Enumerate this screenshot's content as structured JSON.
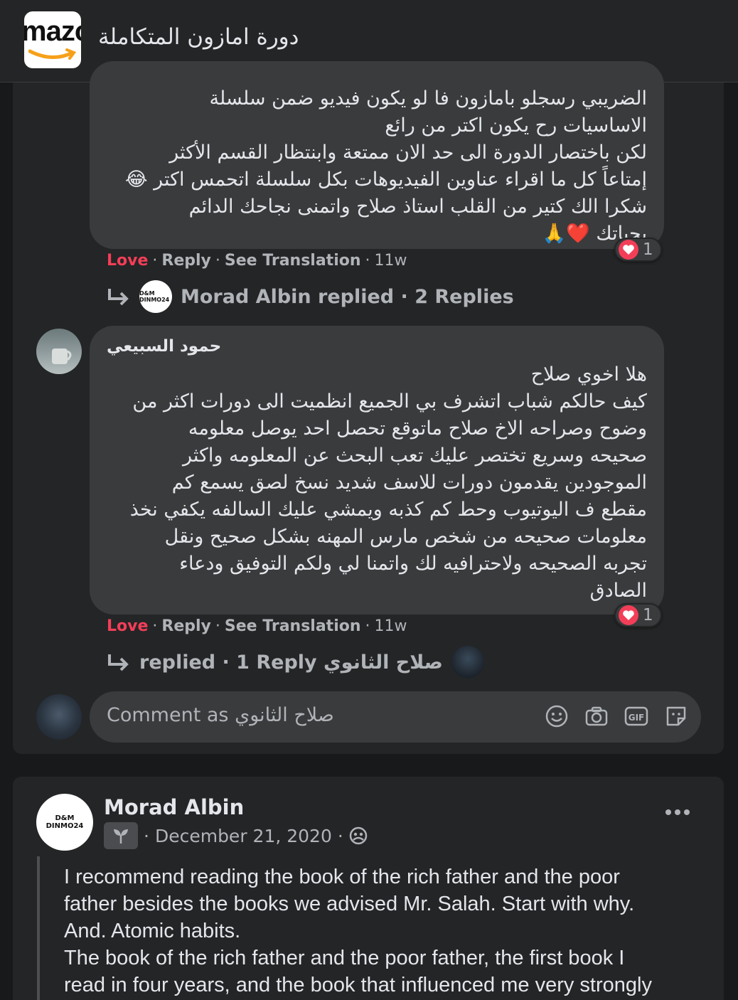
{
  "header": {
    "group_logo_text": "mazo",
    "group_title": "دورة امازون المتكاملة"
  },
  "comment1": {
    "lines": [
      "الضريبي رسجلو بامازون فا لو يكون فيديو ضمن سلسلة",
      "الاساسيات رح يكون اكتر من رائع",
      "لكن باختصار الدورة الى حد الان ممتعة وابنتظار القسم الأكثر",
      "إمتاعاً كل ما اقراء عناوين الفيديوهات بكل سلسلة اتحمس اكتر 😂",
      "شكرا الك كتير من القلب استاذ صلاح واتمنى نجاحك الدائم",
      "بحياتك ❤️🙏"
    ],
    "reaction_count": "1",
    "actions": {
      "love": "Love",
      "reply": "Reply",
      "see_translation": "See Translation",
      "time": "11w"
    },
    "replies": {
      "text": "Morad Albin replied · 2 Replies",
      "avatar_text": "D&M DINMO24"
    }
  },
  "comment2": {
    "author": "حمود السبيعي",
    "lines": [
      "هلا اخوي صلاح",
      "كيف حالكم شباب اتشرف بي الجميع انظميت الى دورات اكثر من",
      "وضوح وصراحه الاخ صلاح ماتوقع تحصل احد يوصل معلومه",
      "صحيحه وسريع تختصر عليك تعب البحث عن المعلومه واكثر",
      "الموجودين يقدمون دورات للاسف شديد نسخ لصق يسمع كم",
      "مقطع ف اليوتيوب وحط كم كذبه ويمشي عليك السالفه يكفي نخذ",
      "معلومات صحيحه من شخص مارس المهنه بشكل صحيح ونقل",
      "تجربه الصحيحه ولاحترافيه لك واتمنا لي ولكم التوفيق ودعاء",
      "الصادق"
    ],
    "reaction_count": "1",
    "actions": {
      "love": "Love",
      "reply": "Reply",
      "see_translation": "See Translation",
      "time": "11w"
    },
    "replies": {
      "text": "صلاح الثانوي replied · 1 Reply"
    }
  },
  "comment_box": {
    "placeholder": "Comment as صلاح الثانوي",
    "icons": [
      "emoji-icon",
      "camera-icon",
      "gif-icon",
      "sticker-icon"
    ]
  },
  "post": {
    "author": "Morad Albin",
    "avatar_text": "D&M DINMO24",
    "date": "December 21, 2020",
    "text_lines": [
      "I recommend reading the book of the rich father and the poor",
      "father besides the books we advised Mr. Salah. Start with why.",
      "And. Atomic habits.",
      "The book of the rich father and the poor father, the first book I",
      "read in four years, and the book that influenced me very strongly"
    ]
  },
  "colors": {
    "background": "#18191a",
    "card": "#242526",
    "bubble": "#3a3b3c",
    "love": "#f33e58",
    "secondary_text": "#b0b3b8"
  }
}
